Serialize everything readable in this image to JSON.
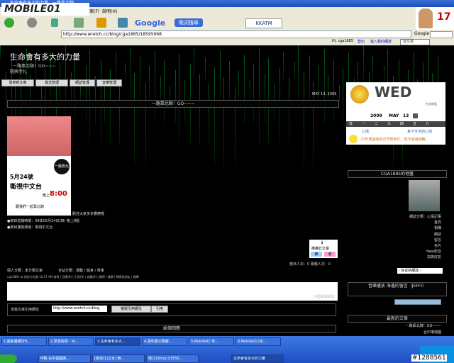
{
  "window": {
    "title": "生命會有多大的力量 - 一路靠北騎"
  },
  "logo": {
    "text": "MOBILE01"
  },
  "menu": {
    "items": [
      "檔案(F)",
      "說明(H)"
    ]
  },
  "toolbar": {
    "google": "Google",
    "search_btn": "歌詞搜尋",
    "kkatm": "KKATM"
  },
  "ad": {
    "number": "17"
  },
  "address": {
    "url": "http://www.wretch.cc/blog/cga1885/18595968",
    "google_label": "Google"
  },
  "linksbar": {
    "greeting": "Hi, cga1885",
    "logout": "登出",
    "enter": "進入我的網誌",
    "ime": "搜尋",
    "search": "找文章"
  },
  "blog": {
    "title": "生命會有多大的力量",
    "subtitle": "一路靠北騎！GO~~~",
    "subtitle2": "隨興手扎",
    "buttons": [
      "發表新文章",
      "樣式管理",
      "網誌管理",
      "音樂管理"
    ],
    "date": "MAY 13, 2009",
    "post_title": "一路靠北騎！GO~~~",
    "poster": {
      "date_big": "5月24號",
      "channel": "衛視中文台",
      "time_prefix": "晚上",
      "time": "8:00",
      "tagline": "跟我們一起靠北騎",
      "badge": "一路靠北騎"
    },
    "caption": "歡迎大家多多響應喔",
    "bullets": [
      "●節目首播時間：09年05月24日(四) 晚上8點",
      "●節目播放頻道：衛視中文台"
    ],
    "recommend": {
      "label": "推薦此文章",
      "btn1": "推",
      "btn2": "收"
    },
    "views": "當日人次：0 累積人次：0",
    "category": "個人分類：未分類文章",
    "site_category": "全站分類：運動 / 健身 / 單車",
    "meta": "cga1885 at 與各分站閱 10:37 AM 發表 | 回應(0) | 引用(0) | 收藏(0) | 轉寄 | 檢舉 | 轉寄給朋友 | 檢舉",
    "comment_hint": "中國爭取網站",
    "trackback_label": "本篇文章引用網址",
    "trackback_url": "http://www.wretch.cc/blog",
    "copy_btn": "複製引用網址",
    "quote_btn": "引用",
    "rate_title": "給個回應"
  },
  "sidebar": {
    "weekday": "WED",
    "weekday_sub": "台北地區",
    "year": "2009",
    "month": "MAY",
    "day": "13",
    "week": [
      "日",
      "一",
      "二",
      "三",
      "四",
      "五",
      "六"
    ],
    "mood_label": "心情",
    "mood_link": "寫下今天的心情",
    "mood_text": "工作:想說有自己不想太忙，但不容易加輯。",
    "profile_title": "CGA1885的地盤",
    "links": [
      "網誌分類：心情記事",
      "首頁",
      "相簿",
      "網誌",
      "留言",
      "名片",
      "New影音",
      "加為好友"
    ],
    "select": "- 好友的網誌 -",
    "music_title": "音樂播放 海邊的留言（JEFFI）",
    "latest_title": "最新的文章",
    "latest": [
      "一路靠北騎！GO~~~",
      "台中環城圈"
    ]
  },
  "taskbar": {
    "row1": [
      "1.最新畫報SHI...",
      "2.至尋信標 - Ya...",
      "3.生命會有多大...",
      "4.嘉利運公務報...",
      "5.Mobile01 世...",
      "6.Mobile01 [Bl..."
    ],
    "row2": [
      "M數-台中福國廣...",
      "[最道(1)之女] 無...",
      "微(1)(0m)| DTESS...",
      "生命會有多大的力量"
    ],
    "clock": "#1288561"
  }
}
